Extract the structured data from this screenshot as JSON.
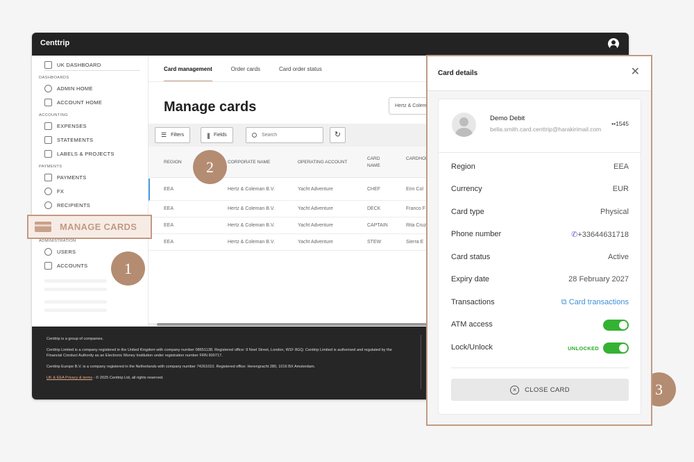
{
  "app": {
    "brand": "Centtrip"
  },
  "sidebar": {
    "top_item": "UK DASHBOARD",
    "sections": {
      "dashboards": "DASHBOARDS",
      "accounting": "ACCOUNTING",
      "payments": "PAYMENTS",
      "administration": "ADMINISTRATION"
    },
    "items": {
      "admin_home": "ADMIN HOME",
      "account_home": "ACCOUNT HOME",
      "expenses": "EXPENSES",
      "statements": "STATEMENTS",
      "labels_projects": "LABELS & PROJECTS",
      "payments": "PAYMENTS",
      "fx": "FX",
      "recipients": "RECIPIENTS",
      "users": "USERS",
      "accounts": "ACCOUNTS"
    },
    "manage_cards": "MANAGE CARDS"
  },
  "tabs": [
    "Card management",
    "Order cards",
    "Card order status"
  ],
  "page": {
    "title": "Manage cards",
    "filter_value": "Hertz & Coleman B.V."
  },
  "toolbar": {
    "filters": "Filters",
    "fields": "Fields",
    "search_placeholder": "Search"
  },
  "table": {
    "headers": [
      "REGION",
      "CORPORATE NAME",
      "OPERATING ACCOUNT",
      "CARD NAME",
      "CARDHOLDER NAME"
    ],
    "rows": [
      [
        "EEA",
        "Hertz & Coleman B.V.",
        "Yacht Adventure",
        "CHEF",
        "Erin Col"
      ],
      [
        "EEA",
        "Hertz & Coleman B.V.",
        "Yacht Adventure",
        "DECK",
        "Franco F"
      ],
      [
        "EEA",
        "Hertz & Coleman B.V.",
        "Yacht Adventure",
        "CAPTAIN",
        "Rita Cruz"
      ],
      [
        "EEA",
        "Hertz & Coleman B.V.",
        "Yacht Adventure",
        "STEW",
        "Sierra E"
      ]
    ]
  },
  "footer": {
    "line1": "Centtrip is a group of companies.",
    "line2": "Centtrip Limited is a company registered in the United Kingdom with company number 08651138. Registered office: 9 Noel Street, London, W1F 8GQ. Centtrip Limited is authorised and regulated by the Financial Conduct Authority as an Electronic Money Institution under registration number FRN 900717.",
    "line3": "Centtrip Europe B.V. is a company registered in the Netherlands with company number 74261010. Registered office: Herengracht 280, 1016 BX Amsterdam.",
    "privacy_link": "UK & EEA Privacy & terms",
    "copyright": " - © 2025 Centtrip Ltd, all rights reserved."
  },
  "markers": [
    "1",
    "2",
    "3"
  ],
  "card_details": {
    "title": "Card details",
    "card_name": "Demo Debit",
    "email": "bella.smith.card.centtrip@harakirimail.com",
    "last4": "••1545",
    "rows": {
      "region": {
        "label": "Region",
        "value": "EEA"
      },
      "currency": {
        "label": "Currency",
        "value": "EUR"
      },
      "card_type": {
        "label": "Card type",
        "value": "Physical"
      },
      "phone": {
        "label": "Phone number",
        "value": "+33644631718"
      },
      "status": {
        "label": "Card status",
        "value": "Active"
      },
      "expiry": {
        "label": "Expiry date",
        "value": "28 February 2027"
      },
      "transactions": {
        "label": "Transactions",
        "value": "Card transactions"
      },
      "atm": {
        "label": "ATM access",
        "on": true
      },
      "lock": {
        "label": "Lock/Unlock",
        "badge": "UNLOCKED",
        "on": true
      }
    },
    "close_button": "CLOSE CARD"
  },
  "colors": {
    "accent": "#c19a84",
    "marker": "#b48c72",
    "toggle_on": "#34b233",
    "link": "#3d8fd6",
    "topbar": "#232323"
  }
}
